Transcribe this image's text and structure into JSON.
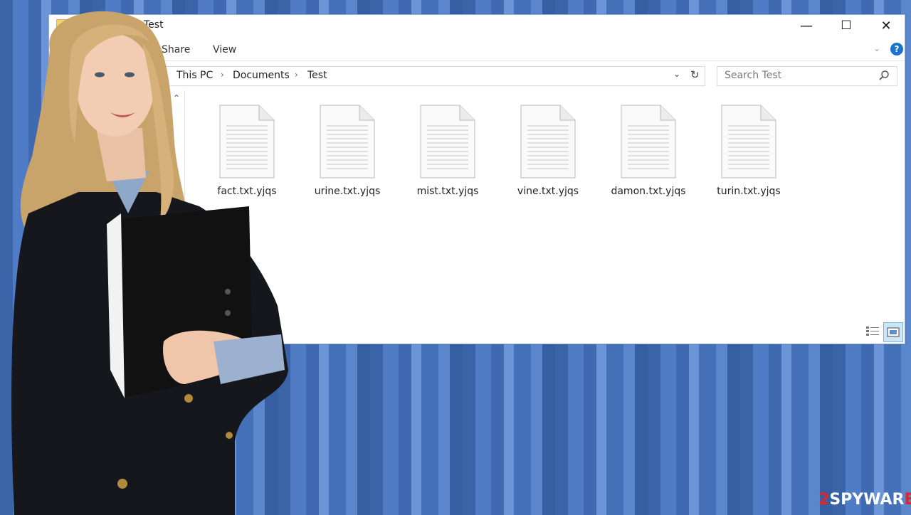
{
  "window": {
    "title": "Test",
    "controls": {
      "minimize": "—",
      "maximize": "☐",
      "close": "✕"
    }
  },
  "ribbon": {
    "tabs": [
      "Share",
      "View"
    ],
    "help": "?"
  },
  "address_bar": {
    "crumbs": [
      "This PC",
      "Documents",
      "Test"
    ]
  },
  "search": {
    "placeholder": "Search Test"
  },
  "files": [
    {
      "name": "fact.txt.yjqs"
    },
    {
      "name": "urine.txt.yjqs"
    },
    {
      "name": "mist.txt.yjqs"
    },
    {
      "name": "vine.txt.yjqs"
    },
    {
      "name": "damon.txt.yjqs"
    },
    {
      "name": "turin.txt.yjqs"
    }
  ],
  "watermark": {
    "prefix": "2",
    "mid": "SPYWAR",
    "suffix": "E"
  },
  "colors": {
    "accent": "#1a73d1",
    "background": "#4f7cc4",
    "watermark_red": "#e0262a"
  }
}
